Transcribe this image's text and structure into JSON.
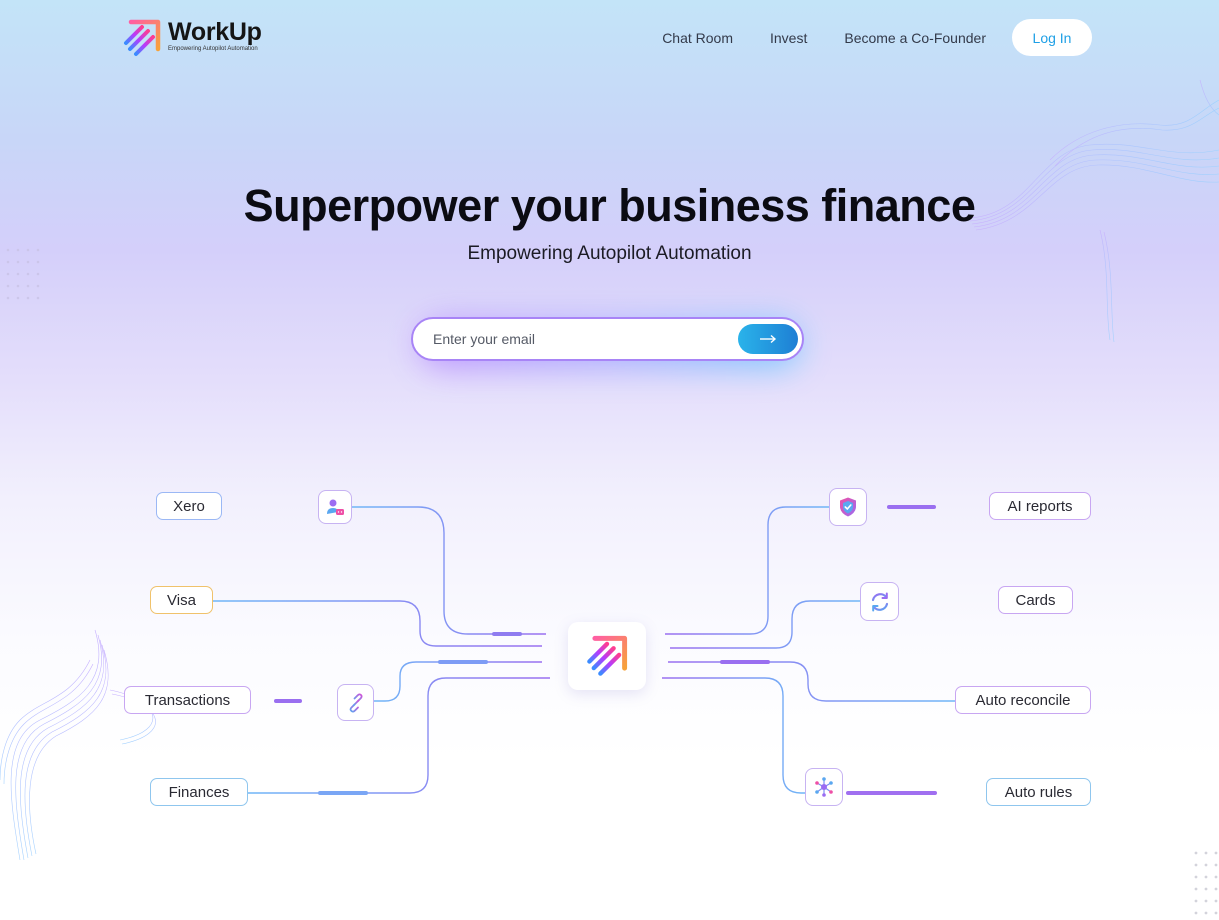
{
  "header": {
    "brand_name": "WorkUp",
    "brand_tagline": "Empowering Autopilot Automation",
    "nav": [
      {
        "label": "Chat Room"
      },
      {
        "label": "Invest"
      },
      {
        "label": "Become a Co-Founder"
      }
    ],
    "login_label": "Log In"
  },
  "hero": {
    "title": "Superpower your business finance",
    "subtitle": "Empowering Autopilot Automation",
    "email_placeholder": "Enter your email",
    "submit_icon": "arrow-right-icon"
  },
  "diagram": {
    "left": [
      {
        "label": "Xero",
        "icon": "user-chat-icon"
      },
      {
        "label": "Visa"
      },
      {
        "label": "Transactions",
        "icon": "link-icon"
      },
      {
        "label": "Finances"
      }
    ],
    "right": [
      {
        "label": "AI reports",
        "icon": "shield-check-icon"
      },
      {
        "label": "Cards",
        "icon": "refresh-icon"
      },
      {
        "label": "Auto reconcile"
      },
      {
        "label": "Auto rules",
        "icon": "network-icon"
      }
    ],
    "center_icon": "workup-logo-icon"
  },
  "colors": {
    "accent_blue": "#1fa0e6",
    "accent_purple": "#a884f6",
    "brand_pink": "#ee3fa6",
    "brand_orange": "#f79a3e"
  }
}
